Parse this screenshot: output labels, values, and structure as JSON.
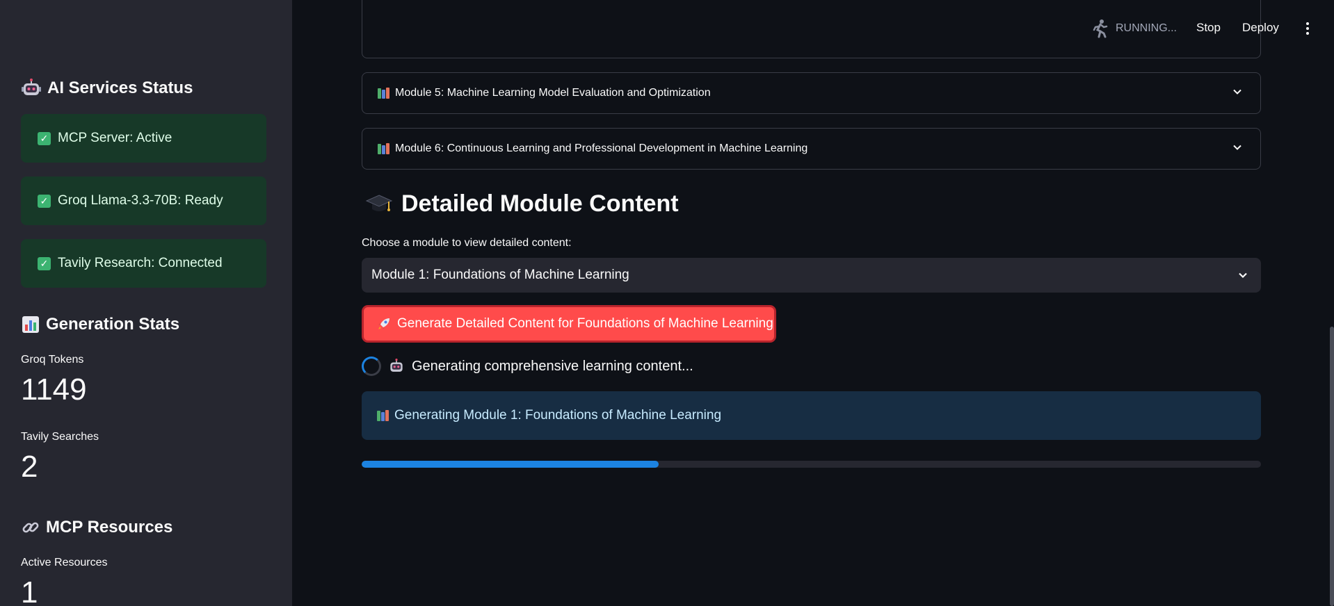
{
  "sidebar": {
    "ai_status": {
      "heading": "AI Services Status",
      "items": [
        {
          "label": "MCP Server: Active"
        },
        {
          "label": "Groq Llama-3.3-70B: Ready"
        },
        {
          "label": "Tavily Research: Connected"
        }
      ]
    },
    "generation_stats": {
      "heading": "Generation Stats",
      "groq_tokens_label": "Groq Tokens",
      "groq_tokens_value": "1149",
      "tavily_searches_label": "Tavily Searches",
      "tavily_searches_value": "2"
    },
    "mcp_resources": {
      "heading": "MCP Resources",
      "active_resources_label": "Active Resources",
      "active_resources_value": "1"
    }
  },
  "header": {
    "status": "RUNNING...",
    "stop_label": "Stop",
    "deploy_label": "Deploy"
  },
  "main": {
    "modules": [
      {
        "label": "Module 5: Machine Learning Model Evaluation and Optimization"
      },
      {
        "label": "Module 6: Continuous Learning and Professional Development in Machine Learning"
      }
    ],
    "detail_heading": "Detailed Module Content",
    "select_label": "Choose a module to view detailed content:",
    "selected_module": "Module 1: Foundations of Machine Learning",
    "generate_button": "Generate Detailed Content for Foundations of Machine Learning",
    "spinner_text": "Generating comprehensive learning content...",
    "info_text": "Generating Module 1: Foundations of Machine Learning",
    "progress": 0.33
  },
  "colors": {
    "sidebar_bg": "#262730",
    "main_bg": "#0e1117",
    "success_bg": "#173928",
    "primary_button": "#ff4b4b",
    "info_bg": "#172d43",
    "progress": "#1c83e1"
  },
  "icons": {
    "ai_status": "robot-icon",
    "status_check": "check-box-icon",
    "stats": "bar-chart-icon",
    "resources": "link-icon",
    "modules": "books-icon",
    "detail": "graduation-cap-icon",
    "generate": "rocket-icon",
    "running": "running-person-icon"
  }
}
